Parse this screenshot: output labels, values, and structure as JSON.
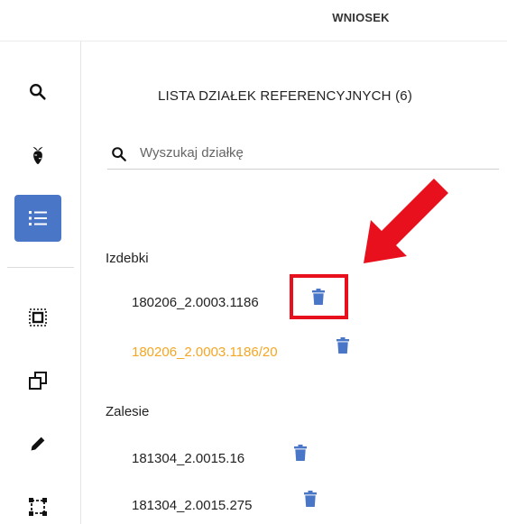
{
  "header": {
    "tab_label": "WNIOSEK"
  },
  "sidebar": {
    "tools": [
      {
        "name": "search-icon",
        "active": false
      },
      {
        "name": "crop-icon",
        "active": false
      },
      {
        "name": "list-icon",
        "active": true
      },
      {
        "name": "select-area-icon",
        "active": false
      },
      {
        "name": "layers-copy-icon",
        "active": false
      },
      {
        "name": "pencil-icon",
        "active": false
      },
      {
        "name": "draw-rectangle-icon",
        "active": false
      }
    ]
  },
  "panel": {
    "title": "LISTA DZIAŁEK REFERENCYJNYCH (6)",
    "search": {
      "placeholder": "Wyszukaj działkę",
      "value": ""
    },
    "groups": [
      {
        "label": "Izdebki",
        "parcels": [
          {
            "id": "180206_2.0003.1186",
            "highlighted": false
          },
          {
            "id": "180206_2.0003.1186/20",
            "highlighted": true
          }
        ]
      },
      {
        "label": "Zalesie",
        "parcels": [
          {
            "id": "181304_2.0015.16",
            "highlighted": false
          },
          {
            "id": "181304_2.0015.275",
            "highlighted": false
          }
        ]
      }
    ]
  },
  "colors": {
    "accent": "#4a76c7",
    "highlight_text": "#f5a623",
    "annotation_red": "#e8101c",
    "trash": "#4a76c7"
  }
}
